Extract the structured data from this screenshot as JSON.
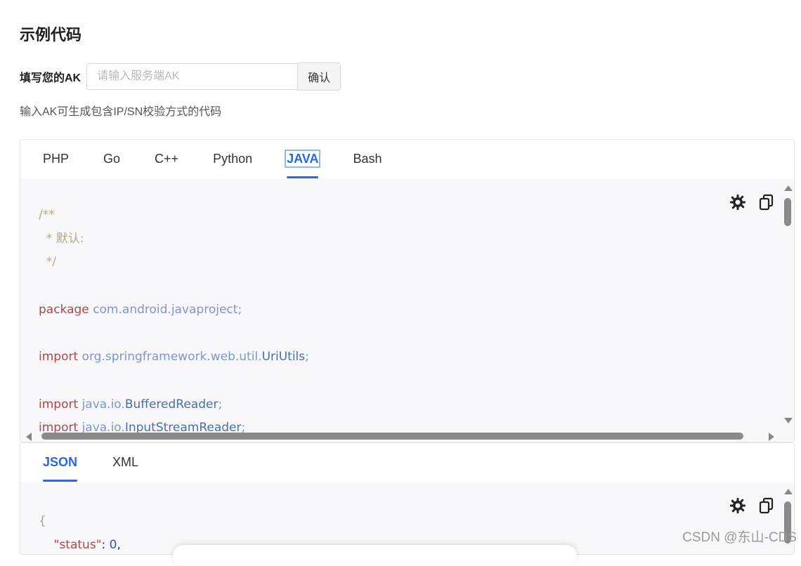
{
  "page": {
    "title": "示例代码",
    "ak_label": "填写您的AK",
    "ak_placeholder": "请输入服务端AK",
    "confirm_label": "确认",
    "hint": "输入AK可生成包含IP/SN校验方式的代码"
  },
  "code_panel": {
    "tabs": [
      {
        "label": "PHP"
      },
      {
        "label": "Go"
      },
      {
        "label": "C++"
      },
      {
        "label": "Python"
      },
      {
        "label": "JAVA",
        "active": true
      },
      {
        "label": "Bash"
      }
    ],
    "code_lines": {
      "l1": "/**",
      "l2": "  * 默认:",
      "l3": "  */",
      "l5_kw": "package",
      "l5_rest": "com.android.javaproject;",
      "l7_kw": "import",
      "l7_pkg": "org.springframework.web.util.",
      "l7_cls": "UriUtils",
      "l7_end": ";",
      "l9_kw": "import",
      "l9_pkg": "java.io.",
      "l9_cls": "BufferedReader",
      "l9_end": ";",
      "l10_kw": "import",
      "l10_pkg": "java.io.",
      "l10_cls": "InputStreamReader",
      "l10_end": ";"
    }
  },
  "response_panel": {
    "tabs": [
      {
        "label": "JSON",
        "active": true
      },
      {
        "label": "XML"
      }
    ],
    "code_lines": {
      "l1": "{",
      "l2_key": "\"status\"",
      "l2_rest": ": ",
      "l2_val": "0",
      "l2_end": ","
    }
  },
  "watermark": "CSDN @东山-CDS",
  "icons": [
    "theme-toggle-icon",
    "copy-icon"
  ],
  "colors": {
    "accent": "#2468f2",
    "keyword": "#b0454b",
    "comment": "#b5a883",
    "package": "#7f96c8"
  }
}
